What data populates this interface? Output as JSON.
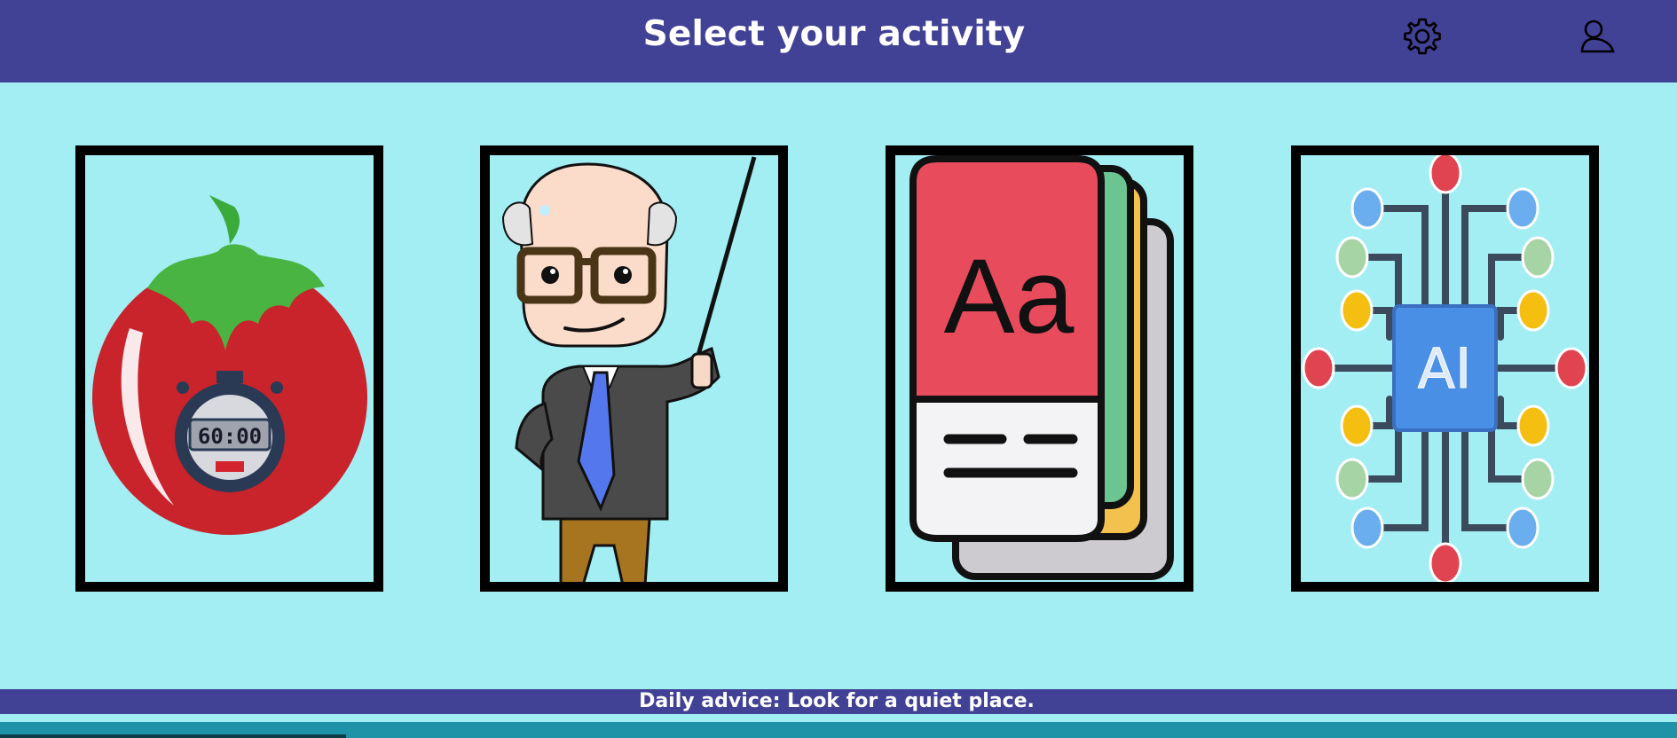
{
  "header": {
    "title": "Select your activity",
    "icons": [
      "gear-icon",
      "user-icon"
    ]
  },
  "activities": [
    {
      "id": "pomodoro",
      "icon": "pomodoro-timer-icon",
      "timer_display": "60:00"
    },
    {
      "id": "teacher",
      "icon": "teacher-icon"
    },
    {
      "id": "dictionary",
      "icon": "dictionary-books-icon",
      "book_label": "Aa"
    },
    {
      "id": "ai",
      "icon": "ai-chip-icon",
      "chip_label": "AI"
    }
  ],
  "footer": {
    "advice": "Daily advice: Look for a quiet place."
  },
  "colors": {
    "header_bg": "#414196",
    "page_bg": "#a2eef3",
    "bottom_strip": "#1e93a8"
  }
}
